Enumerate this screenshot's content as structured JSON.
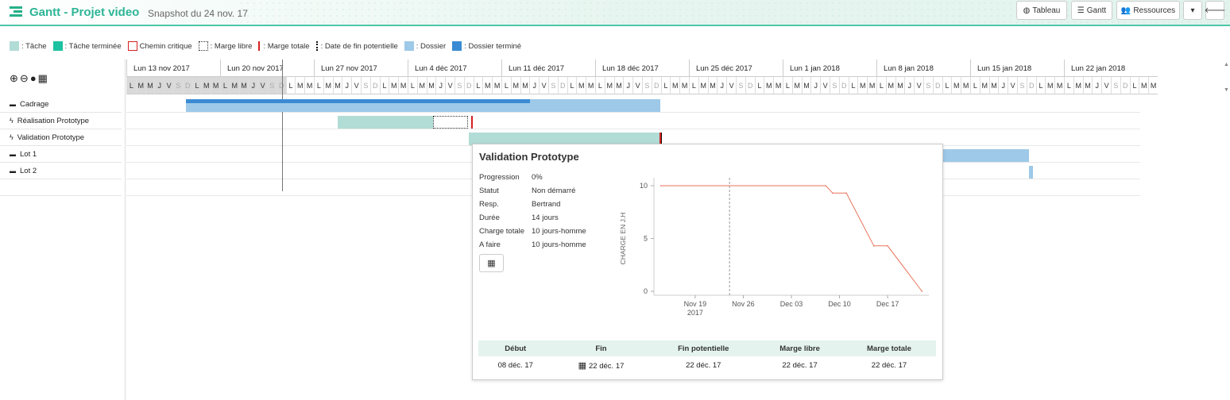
{
  "header": {
    "title": "Gantt - Projet video",
    "subtitle": "Snapshot du 24 nov. 17",
    "buttons": {
      "tableau": "Tableau",
      "gantt": "Gantt",
      "ressources": "Ressources"
    },
    "accent_color": "#2db596"
  },
  "legend": {
    "tache": ": Tâche",
    "tache_terminee": ": Tâche terminée",
    "chemin_critique": "Chemin critique",
    "marge_libre": ": Marge libre",
    "marge_totale": ": Marge totale",
    "date_fin_potentielle": ": Date de fin potentielle",
    "dossier": ": Dossier",
    "dossier_termine": ": Dossier terminé"
  },
  "colors": {
    "tache": "#b2dcd6",
    "tache_terminee": "#1ec2a0",
    "critique": "#d61f1f",
    "dossier": "#9ec9e8",
    "dossier_termine": "#3a8bd4"
  },
  "tasks": [
    {
      "icon": "folder-icon",
      "label": "Cadrage"
    },
    {
      "icon": "bolt-icon",
      "label": "Réalisation Prototype"
    },
    {
      "icon": "bolt-icon",
      "label": "Validation Prototype"
    },
    {
      "icon": "folder-icon",
      "label": "Lot 1"
    },
    {
      "icon": "folder-icon",
      "label": "Lot 2"
    }
  ],
  "weeks": [
    "Lun 13 nov 2017",
    "Lun 20 nov 2017",
    "Lun 27 nov 2017",
    "Lun 4 déc 2017",
    "Lun 11 déc 2017",
    "Lun 18 déc 2017",
    "Lun 25 déc 2017",
    "Lun 1 jan 2018",
    "Lun 8 jan 2018",
    "Lun 15 jan 2018",
    "Lun 22 jan 2018"
  ],
  "day_letters": [
    "L",
    "M",
    "M",
    "J",
    "V",
    "S",
    "D"
  ],
  "popup": {
    "title": "Validation Prototype",
    "fields": [
      {
        "k": "Progression",
        "v": "0%"
      },
      {
        "k": "Statut",
        "v": "Non démarré"
      },
      {
        "k": "Resp.",
        "v": "Bertrand"
      },
      {
        "k": "Durée",
        "v": "14 jours"
      },
      {
        "k": "Charge totale",
        "v": "10 jours-homme"
      },
      {
        "k": "A faire",
        "v": "10 jours-homme"
      }
    ],
    "summary_headers": [
      "Début",
      "Fin",
      "Fin potentielle",
      "Marge libre",
      "Marge totale"
    ],
    "summary_values": [
      "08 déc. 17",
      "22 déc. 17",
      "22 déc. 17",
      "22 déc. 17",
      "22 déc. 17"
    ]
  },
  "chart_data": {
    "type": "line",
    "title": "",
    "xlabel": "",
    "ylabel": "CHARGE EN J.H",
    "ylim": [
      0,
      10
    ],
    "yticks": [
      "0",
      "5",
      "10"
    ],
    "xticks": [
      {
        "label": "Nov 19",
        "sub": "2017"
      },
      {
        "label": "Nov 26",
        "sub": ""
      },
      {
        "label": "Dec 03",
        "sub": ""
      },
      {
        "label": "Dec 10",
        "sub": ""
      },
      {
        "label": "Dec 17",
        "sub": ""
      }
    ],
    "series": [
      {
        "x": [
          "2017-11-14",
          "2017-12-08",
          "2017-12-09",
          "2017-12-11",
          "2017-12-15",
          "2017-12-17",
          "2017-12-22"
        ],
        "y": [
          10,
          10,
          9.3,
          9.3,
          4.3,
          4.3,
          0
        ]
      }
    ],
    "reference_line_x": "2017-11-24",
    "line_color": "#e8735a"
  }
}
